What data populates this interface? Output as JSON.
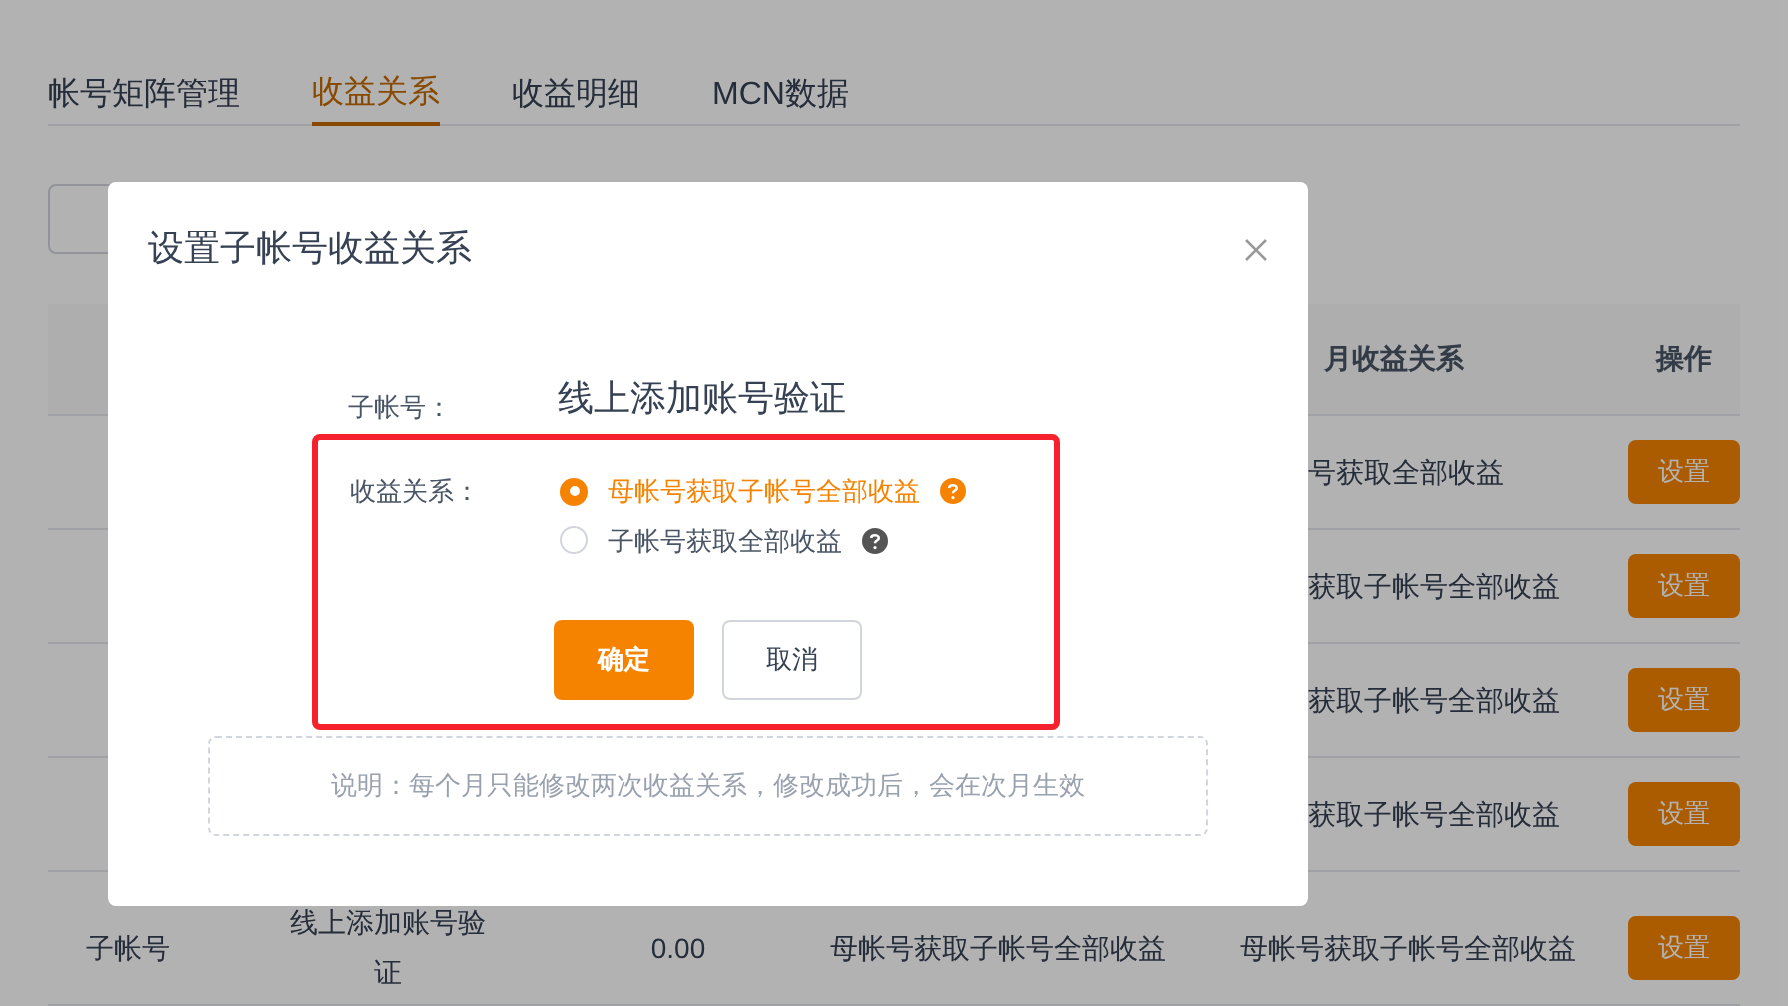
{
  "tabs": [
    {
      "label": "帐号矩阵管理",
      "selected": false
    },
    {
      "label": "收益关系",
      "selected": true
    },
    {
      "label": "收益明细",
      "selected": false
    },
    {
      "label": "MCN数据",
      "selected": false
    }
  ],
  "table": {
    "header": [
      "月收益关系",
      "操作"
    ],
    "rows": [
      {
        "kind": "partial",
        "cells": [
          "号获取全部收益"
        ],
        "action": "设置"
      },
      {
        "kind": "partial",
        "cells": [
          "获取子帐号全部收益"
        ],
        "action": "设置"
      },
      {
        "kind": "partial",
        "cells": [
          "获取子帐号全部收益"
        ],
        "action": "设置"
      },
      {
        "kind": "partial",
        "cells": [
          "获取子帐号全部收益"
        ],
        "action": "设置"
      },
      {
        "kind": "full",
        "cells": [
          "子帐号",
          "线上添加账号验证",
          "0.00",
          "母帐号获取子帐号全部收益",
          "母帐号获取子帐号全部收益"
        ],
        "action": "设置"
      }
    ]
  },
  "dialog": {
    "title": "设置子帐号收益关系",
    "account_label": "子帐号：",
    "account_value": "线上添加账号验证",
    "relation_label": "收益关系：",
    "options": [
      {
        "label": "母帐号获取子帐号全部收益",
        "selected": true
      },
      {
        "label": "子帐号获取全部收益",
        "selected": false
      }
    ],
    "confirm": "确定",
    "cancel": "取消",
    "note": "说明：每个月只能修改两次收益关系，修改成功后，会在次月生效"
  }
}
